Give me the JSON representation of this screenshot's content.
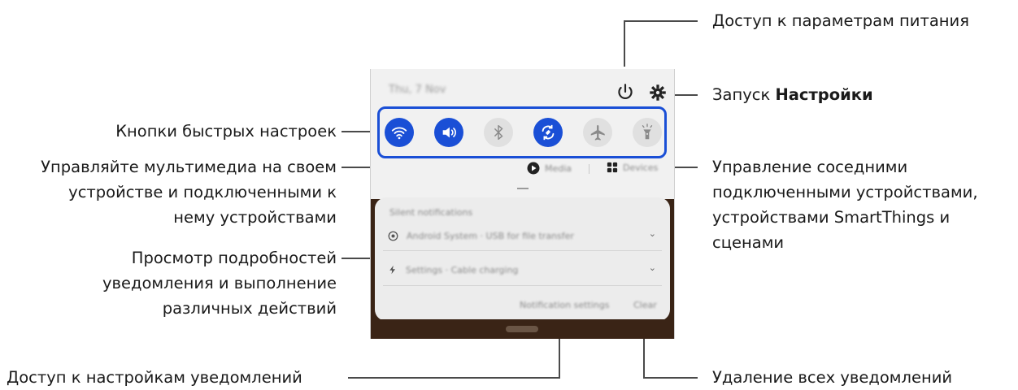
{
  "callouts": {
    "power": "Доступ к параметрам питания",
    "settings_prefix": "Запуск ",
    "settings_bold": "Настройки",
    "quick_settings": "Кнопки быстрых настроек",
    "media": [
      "Управляйте мультимедиа на своем",
      "устройстве и подключенными к",
      "нему устройствами"
    ],
    "devices": [
      "Управление соседними",
      "подключенными устройствами,",
      "устройствами SmartThings и",
      "сценами"
    ],
    "notif_details": [
      "Просмотр подробностей",
      "уведомления и выполнение",
      "различных действий"
    ],
    "notif_settings": "Доступ к настройкам уведомлений",
    "clear_all": "Удаление всех уведомлений"
  },
  "phone": {
    "date": "Thu, 7 Nov",
    "quick_buttons": [
      {
        "icon": "wifi-icon",
        "state": "on"
      },
      {
        "icon": "sound-icon",
        "state": "on"
      },
      {
        "icon": "bluetooth-icon",
        "state": "off"
      },
      {
        "icon": "auto-rotate-icon",
        "state": "on"
      },
      {
        "icon": "airplane-icon",
        "state": "off"
      },
      {
        "icon": "flashlight-icon",
        "state": "off"
      }
    ],
    "media_label": "Media",
    "devices_label": "Devices",
    "notif_header": "Silent notifications",
    "notif_items": [
      {
        "icon": "android-system-icon",
        "text": "Android System · USB for file transfer"
      },
      {
        "icon": "charging-icon",
        "text": "Settings · Cable charging"
      }
    ],
    "notif_settings_label": "Notification settings",
    "clear_label": "Clear"
  },
  "colors": {
    "accent": "#1a4fd6",
    "line": "#4a4a4a"
  }
}
